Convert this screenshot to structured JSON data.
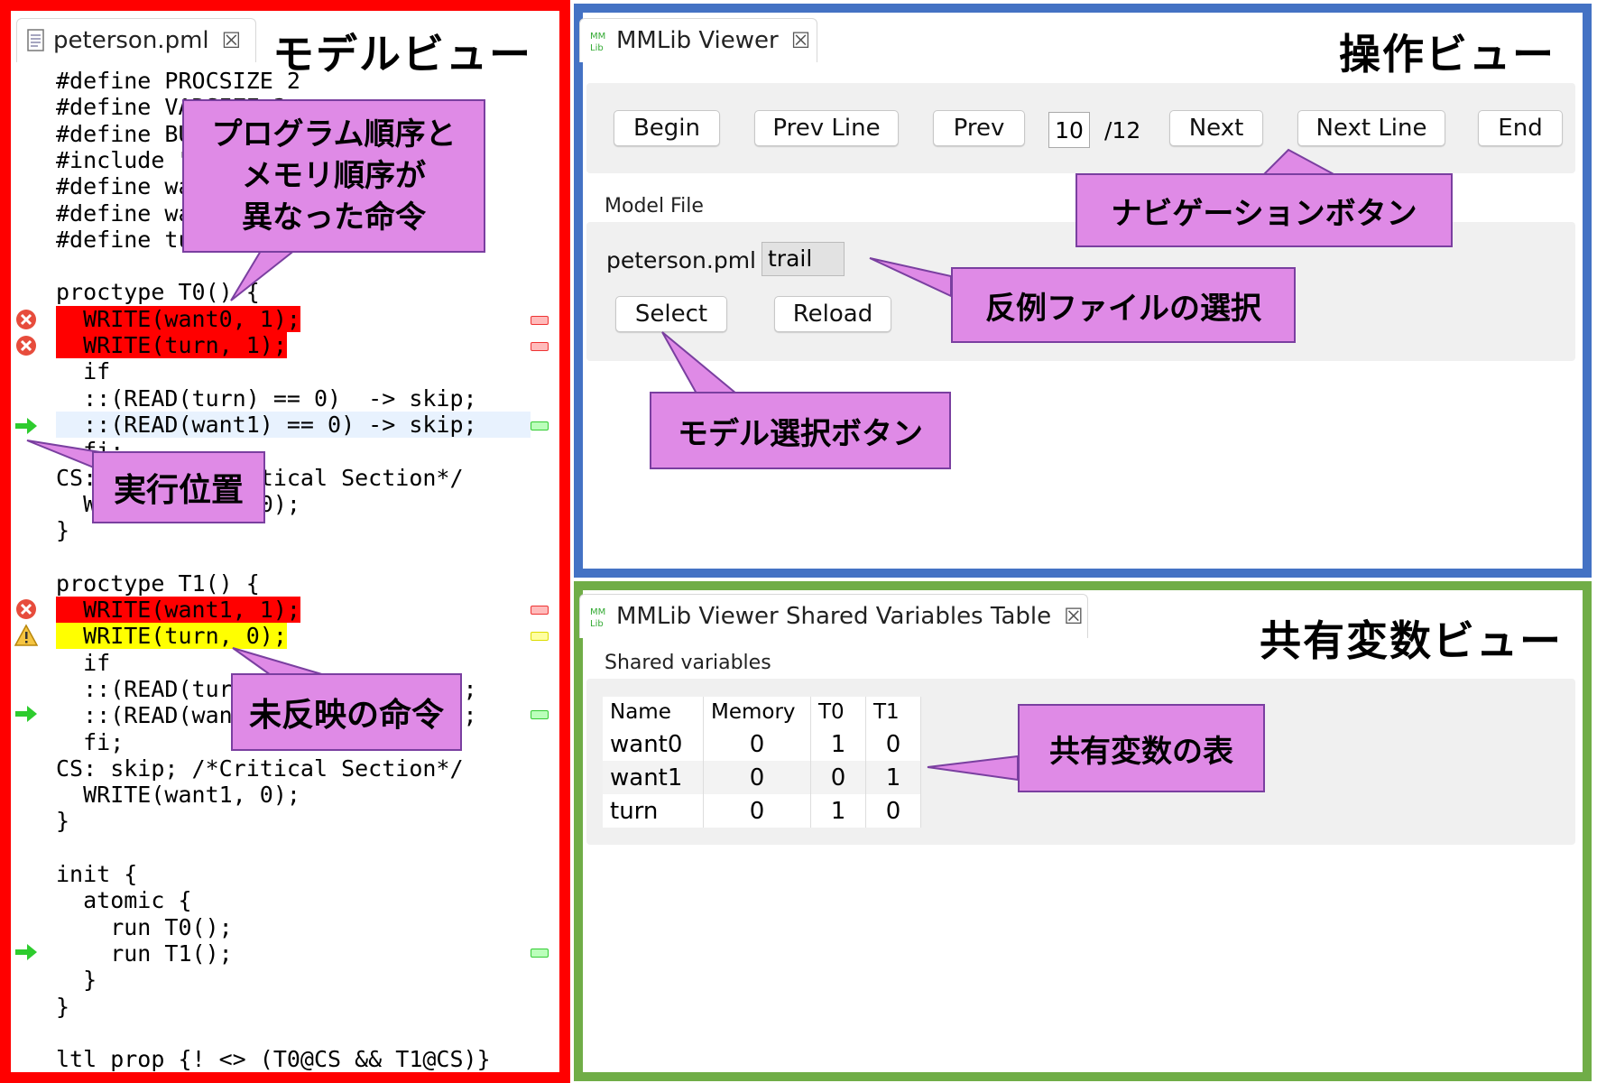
{
  "model_view": {
    "frame_label": "モデルビュー",
    "tab_title": "peterson.pml",
    "close_glyph": "☒",
    "code_lines": [
      "#define PROCSIZE 2",
      "#define VARSIZE 3",
      "#define BUFFSIZE 2",
      "#include \"mm.pml\"",
      "#define want0 0",
      "#define want1 1",
      "#define turn 2",
      "",
      "proctype T0() {",
      "  WRITE(want0, 1);",
      "  WRITE(turn, 1);",
      "  if",
      "  ::(READ(turn) == 0)  -> skip;",
      "  ::(READ(want1) == 0) -> skip;",
      "  fi;",
      "CS: skip; /*Critical Section*/",
      "  WRITE(want0, 0);",
      "}",
      "",
      "proctype T1() {",
      "  WRITE(want1, 1);",
      "  WRITE(turn, 0);",
      "  if",
      "  ::(READ(turn) == 1)  -> skip;",
      "  ::(READ(want0) == 0) -> skip;",
      "  fi;",
      "CS: skip; /*Critical Section*/",
      "  WRITE(want1, 0);",
      "}",
      "",
      "init {",
      "  atomic {",
      "    run T0();",
      "    run T1();",
      "  }",
      "}",
      "",
      "ltl prop {! <> (T0@CS && T1@CS)}"
    ],
    "highlight_colors": {
      "reordered": "#ff0000",
      "unreflected": "#ffff00",
      "current": "#e8f2fe"
    }
  },
  "operation_view": {
    "frame_label": "操作ビュー",
    "tab_title": "MMLib Viewer",
    "close_glyph": "☒",
    "nav": {
      "begin": "Begin",
      "prev_line": "Prev Line",
      "prev": "Prev",
      "step": "10",
      "total": "/12",
      "next": "Next",
      "next_line": "Next Line",
      "end": "End"
    },
    "model_file_label": "Model File",
    "model_file_name": "peterson.pml",
    "trail_value": "trail",
    "select_label": "Select",
    "reload_label": "Reload"
  },
  "shared_view": {
    "frame_label": "共有変数ビュー",
    "tab_title": "MMLib Viewer Shared Variables Table",
    "close_glyph": "☒",
    "section_label": "Shared variables",
    "columns": [
      "Name",
      "Memory",
      "T0",
      "T1"
    ],
    "rows": [
      [
        "want0",
        "0",
        "1",
        "0"
      ],
      [
        "want1",
        "0",
        "0",
        "1"
      ],
      [
        "turn",
        "0",
        "1",
        "0"
      ]
    ]
  },
  "callouts": {
    "reorder": "プログラム順序と\nメモリ順序が\n異なった命令",
    "exec_pos": "実行位置",
    "unreflected": "未反映の命令",
    "nav_buttons": "ナビゲーションボタン",
    "trail_select": "反例ファイルの選択",
    "model_select": "モデル選択ボタン",
    "shared_table": "共有変数の表"
  },
  "colors": {
    "model_frame": "#ff0000",
    "ops_frame": "#4472c4",
    "shared_frame": "#70ad47",
    "callout_fill": "#df8ae6",
    "callout_border": "#7a3fa0"
  }
}
